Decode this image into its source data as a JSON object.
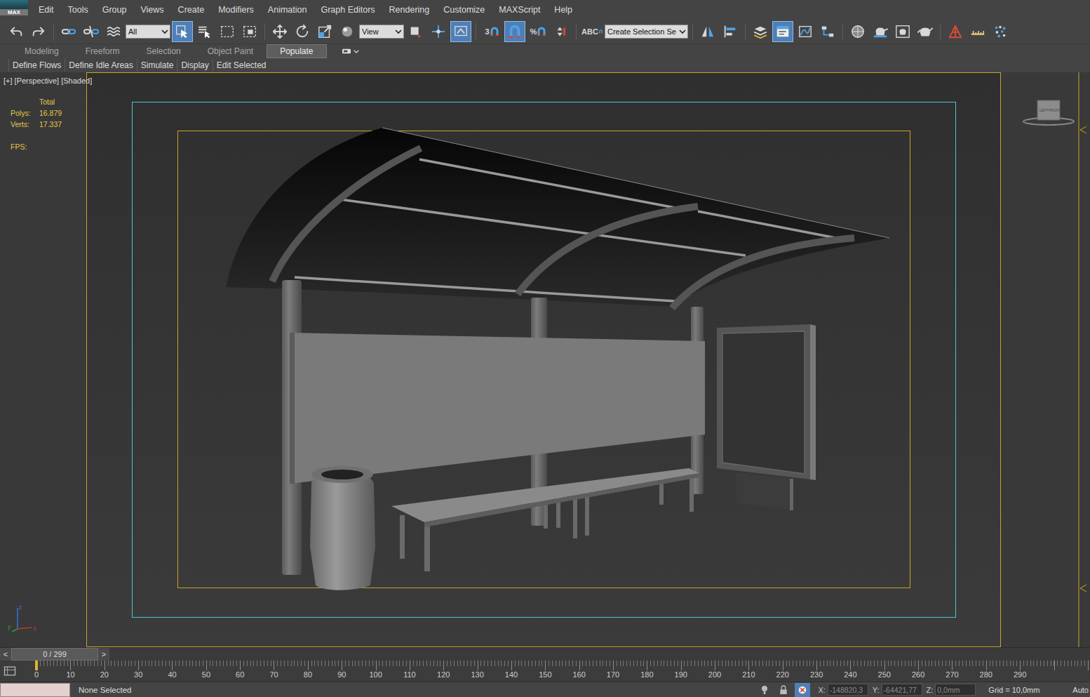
{
  "app_logo": "MAX",
  "menu": [
    "Edit",
    "Tools",
    "Group",
    "Views",
    "Create",
    "Modifiers",
    "Animation",
    "Graph Editors",
    "Rendering",
    "Customize",
    "MAXScript",
    "Help"
  ],
  "toolbar": {
    "items": [
      {
        "kind": "button",
        "active": false
      },
      {
        "kind": "button",
        "active": false
      },
      {
        "kind": "separator"
      },
      {
        "kind": "button",
        "active": false
      },
      {
        "kind": "button",
        "active": false
      },
      {
        "kind": "button",
        "active": false
      },
      {
        "kind": "dropdown",
        "value": "All"
      },
      {
        "kind": "button",
        "active": true
      },
      {
        "kind": "button",
        "active": false
      },
      {
        "kind": "button",
        "active": false
      },
      {
        "kind": "button",
        "active": false
      },
      {
        "kind": "separator"
      },
      {
        "kind": "button",
        "active": false
      },
      {
        "kind": "button",
        "active": false
      },
      {
        "kind": "button",
        "active": false
      },
      {
        "kind": "button",
        "active": false
      },
      {
        "kind": "dropdown",
        "value": "View"
      },
      {
        "kind": "button",
        "active": false
      },
      {
        "kind": "button",
        "active": false
      },
      {
        "kind": "button",
        "active": true
      },
      {
        "kind": "separator"
      },
      {
        "kind": "glyph",
        "text": "3",
        "active": false
      },
      {
        "kind": "button",
        "active": true
      },
      {
        "kind": "glyph",
        "text": "%",
        "active": false
      },
      {
        "kind": "button",
        "active": false
      },
      {
        "kind": "separator"
      },
      {
        "kind": "glyph",
        "text": "ABC",
        "active": false
      },
      {
        "kind": "dropdown",
        "value": "Create Selection Se"
      },
      {
        "kind": "separator"
      },
      {
        "kind": "button",
        "active": false
      },
      {
        "kind": "button",
        "active": false
      },
      {
        "kind": "separator"
      },
      {
        "kind": "button",
        "active": false
      },
      {
        "kind": "button",
        "active": true
      },
      {
        "kind": "button",
        "active": false
      },
      {
        "kind": "button",
        "active": false
      },
      {
        "kind": "separator"
      },
      {
        "kind": "button",
        "active": false
      },
      {
        "kind": "button",
        "active": false
      },
      {
        "kind": "button",
        "active": false
      },
      {
        "kind": "button",
        "active": false
      },
      {
        "kind": "separator"
      },
      {
        "kind": "button",
        "active": false
      },
      {
        "kind": "button",
        "active": false
      },
      {
        "kind": "button",
        "active": false
      }
    ]
  },
  "ribbon": {
    "tabs": [
      {
        "label": "Modeling",
        "selected": false
      },
      {
        "label": "Freeform",
        "selected": false
      },
      {
        "label": "Selection",
        "selected": false
      },
      {
        "label": "Object Paint",
        "selected": false
      },
      {
        "label": "Populate",
        "selected": true
      }
    ],
    "buttons": [
      "Define Flows",
      "Define Idle Areas",
      "Simulate",
      "Display",
      "Edit Selected"
    ]
  },
  "viewport": {
    "label": "[+] [Perspective] [Shaded]",
    "stats_header": "Total",
    "stats": [
      {
        "label": "Polys:",
        "value": "16.879"
      },
      {
        "label": "Verts:",
        "value": "17.337"
      }
    ],
    "fps_label": "FPS:",
    "viewcube": [
      "LEFT",
      "FRONT"
    ],
    "axes": [
      "z",
      "y",
      "x"
    ]
  },
  "time_slider": {
    "prev": "<",
    "value": "0 / 299",
    "next": ">",
    "level": 0
  },
  "track_bar": {
    "ticks": [
      "0",
      "10",
      "20",
      "30",
      "40",
      "50",
      "60",
      "70",
      "80",
      "90",
      "100",
      "110",
      "120",
      "130",
      "140",
      "150",
      "160",
      "170",
      "180",
      "190",
      "200",
      "210",
      "220",
      "230",
      "240",
      "250",
      "260",
      "270",
      "280",
      "290"
    ]
  },
  "status_bar": {
    "selection": "None Selected",
    "coords": [
      {
        "label": "X:",
        "value": "-148820,3"
      },
      {
        "label": "Y:",
        "value": "-64421,77"
      },
      {
        "label": "Z:",
        "value": "0,0mm"
      }
    ],
    "grid": "Grid = 10,0mm",
    "auto": "Auto"
  }
}
